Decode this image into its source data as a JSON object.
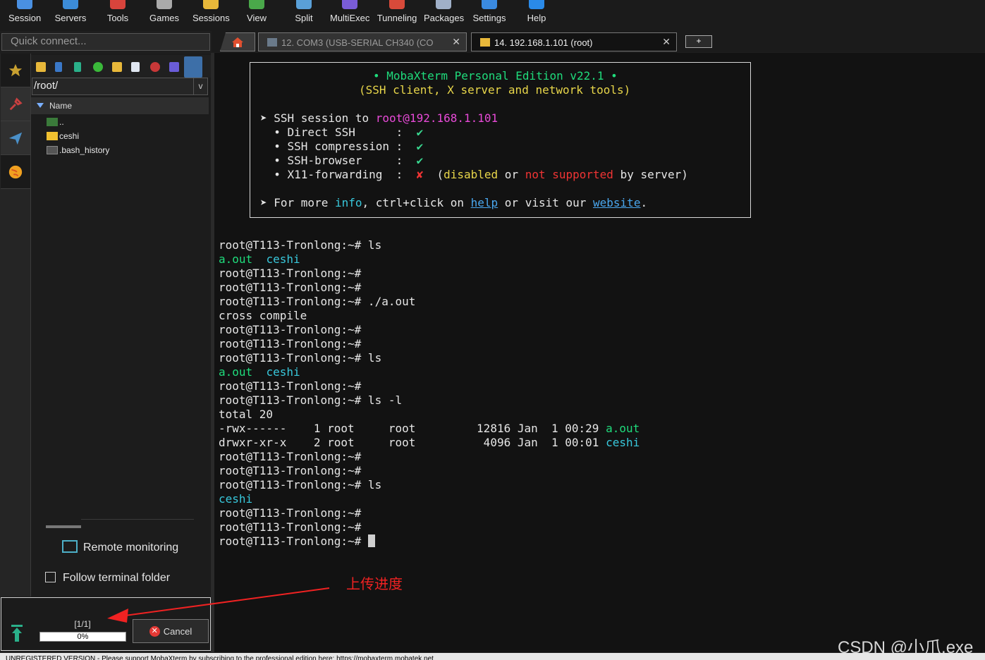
{
  "toolbar": {
    "items": [
      {
        "label": "Session",
        "icon": "session-icon",
        "color": "#4a90e2"
      },
      {
        "label": "Servers",
        "icon": "servers-icon",
        "color": "#3c8cd8"
      },
      {
        "label": "Tools",
        "icon": "tools-icon",
        "color": "#d8443c"
      },
      {
        "label": "Games",
        "icon": "games-icon",
        "color": "#aaaaaa"
      },
      {
        "label": "Sessions",
        "icon": "sessions-icon",
        "color": "#e8b83a"
      },
      {
        "label": "View",
        "icon": "view-icon",
        "color": "#4aa84a"
      },
      {
        "label": "Split",
        "icon": "split-icon",
        "color": "#5aa0d8"
      },
      {
        "label": "MultiExec",
        "icon": "multiexec-icon",
        "color": "#7a5cd8"
      },
      {
        "label": "Tunneling",
        "icon": "tunneling-icon",
        "color": "#d84a3a"
      },
      {
        "label": "Packages",
        "icon": "packages-icon",
        "color": "#a0b0c8"
      },
      {
        "label": "Settings",
        "icon": "settings-icon",
        "color": "#3a8ae0"
      },
      {
        "label": "Help",
        "icon": "help-icon",
        "color": "#2a8ae8"
      }
    ]
  },
  "quick_connect": {
    "placeholder": "Quick connect..."
  },
  "sftp": {
    "path": "/root/",
    "column_name": "Name",
    "files": [
      {
        "name": "..",
        "icon": "parent-folder-icon"
      },
      {
        "name": "ceshi",
        "icon": "folder-icon"
      },
      {
        "name": ".bash_history",
        "icon": "file-icon"
      }
    ],
    "remote_monitoring": "Remote monitoring",
    "follow_terminal_folder": "Follow terminal folder"
  },
  "upload": {
    "count": "[1/1]",
    "progress_text": "0%",
    "progress": 0,
    "cancel_label": "Cancel"
  },
  "tabs": [
    {
      "label": "12.  COM3  (USB-SERIAL CH340 (CO",
      "active": false
    },
    {
      "label": "14.  192.168.1.101 (root)",
      "active": true
    }
  ],
  "new_tab": "+",
  "banner": {
    "title": "• MobaXterm Personal Edition v22.1 •",
    "subtitle": "(SSH client, X server and network tools)",
    "ssh_prefix": "➤ SSH session to ",
    "ssh_target": "root@192.168.1.101",
    "direct_ssh": "  • Direct SSH      :  ",
    "ssh_compression": "  • SSH compression :  ",
    "ssh_browser": "  • SSH-browser     :  ",
    "x11": "  • X11-forwarding  :  ",
    "check": "✔",
    "cross": "✘",
    "x11_open": "  (",
    "x11_disabled": "disabled",
    "x11_or": " or ",
    "x11_not_supported": "not supported",
    "x11_tail": " by server)",
    "more_prefix": "➤ For more ",
    "info": "info",
    "more_mid": ", ctrl+click on ",
    "help": "help",
    "more_mid2": " or visit our ",
    "website": "website",
    "more_end": "."
  },
  "terminal": {
    "prompt": "root@T113-Tronlong:~#",
    "lines": [
      {
        "type": "cmd",
        "text": " ls"
      },
      {
        "type": "ls",
        "text": "a.out  ceshi"
      },
      {
        "type": "cmd",
        "text": ""
      },
      {
        "type": "cmd",
        "text": ""
      },
      {
        "type": "cmd",
        "text": " ./a.out"
      },
      {
        "type": "out",
        "text": "cross compile"
      },
      {
        "type": "cmd",
        "text": ""
      },
      {
        "type": "cmd",
        "text": ""
      },
      {
        "type": "cmd",
        "text": " ls"
      },
      {
        "type": "ls",
        "text": "a.out  ceshi"
      },
      {
        "type": "cmd",
        "text": ""
      },
      {
        "type": "cmd",
        "text": " ls -l"
      },
      {
        "type": "out",
        "text": "total 20"
      },
      {
        "type": "lsl",
        "text": "-rwx------    1 root     root         12816 Jan  1 00:29 ",
        "name": "a.out"
      },
      {
        "type": "lsl",
        "text": "drwxr-xr-x    2 root     root          4096 Jan  1 00:01 ",
        "name": "ceshi"
      },
      {
        "type": "cmd",
        "text": ""
      },
      {
        "type": "cmd",
        "text": ""
      },
      {
        "type": "cmd",
        "text": " ls"
      },
      {
        "type": "ls",
        "text": "ceshi"
      },
      {
        "type": "cmd",
        "text": ""
      },
      {
        "type": "cmd",
        "text": ""
      },
      {
        "type": "cmd",
        "text": " "
      }
    ]
  },
  "annotation": {
    "text": "上传进度",
    "color": "#f02222"
  },
  "watermark": "CSDN @小爪.exe",
  "status_bar": "UNREGISTERED VERSION  -  Please support MobaXterm by subscribing to the professional edition here:  https://mobaxterm.mobatek.net"
}
